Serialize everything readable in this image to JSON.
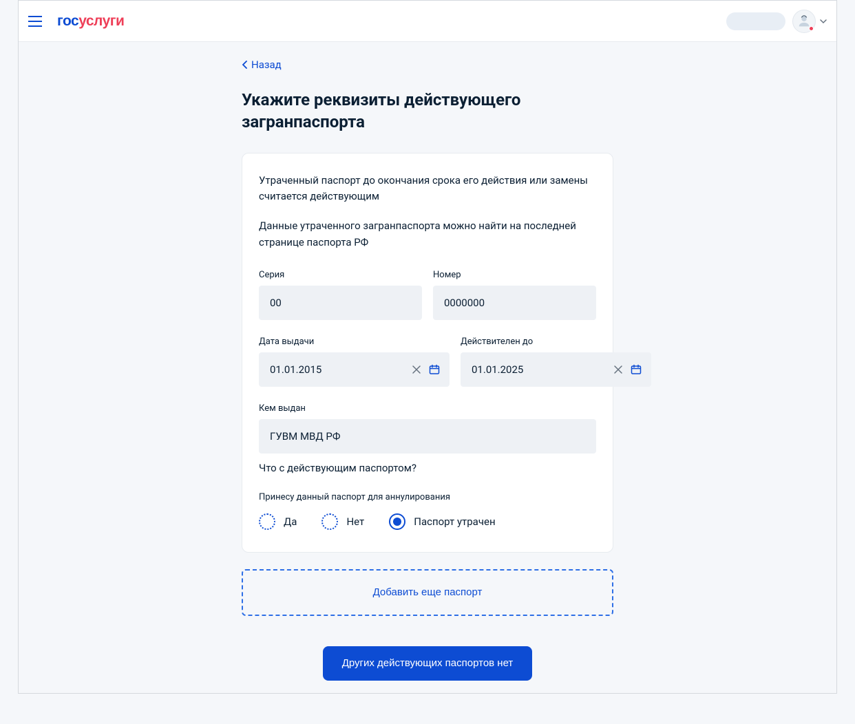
{
  "logo": {
    "part1": "гос",
    "part2": "услуги"
  },
  "nav": {
    "back": "Назад"
  },
  "page": {
    "title": "Укажите реквизиты действующего загранпаспорта"
  },
  "info": {
    "p1": "Утраченный паспорт до окончания срока его действия или замены считается действующим",
    "p2": "Данные утраченного загранпаспорта можно найти на последней странице паспорта РФ"
  },
  "fields": {
    "series": {
      "label": "Серия",
      "value": "00"
    },
    "number": {
      "label": "Номер",
      "value": "0000000"
    },
    "issue_date": {
      "label": "Дата выдачи",
      "value": "01.01.2015"
    },
    "valid_until": {
      "label": "Действителен до",
      "value": "01.01.2025"
    },
    "issued_by": {
      "label": "Кем выдан",
      "value": "ГУВМ МВД РФ"
    }
  },
  "question": {
    "title": "Что с действующим паспортом?",
    "subtitle": "Принесу данный паспорт для аннулирования",
    "options": {
      "yes": "Да",
      "no": "Нет",
      "lost": "Паспорт утрачен"
    }
  },
  "buttons": {
    "add": "Добавить еще паспорт",
    "submit": "Других действующих паспортов нет"
  }
}
